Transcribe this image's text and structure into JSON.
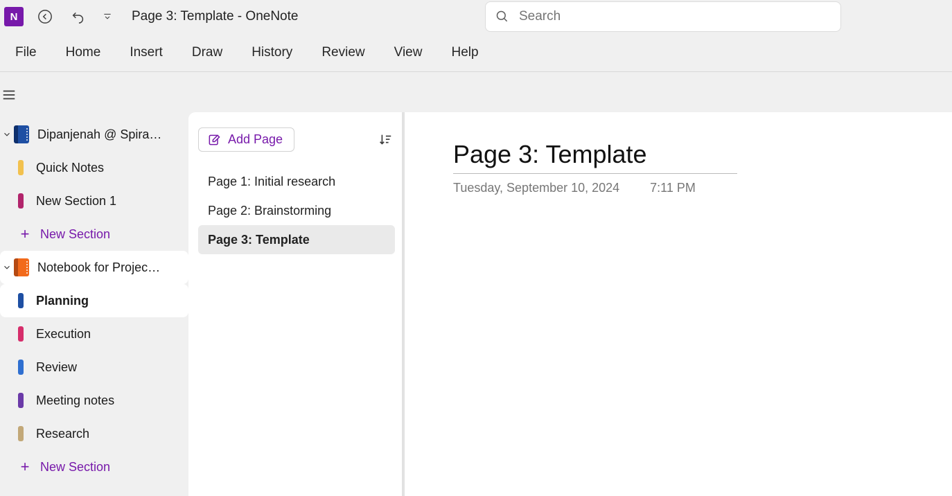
{
  "titlebar": {
    "doc_title": "Page 3: Template  -  OneNote",
    "search_placeholder": "Search",
    "app_icon_text": "N"
  },
  "ribbon": {
    "tabs": [
      "File",
      "Home",
      "Insert",
      "Draw",
      "History",
      "Review",
      "View",
      "Help"
    ]
  },
  "sidebar": {
    "notebooks": [
      {
        "name": "Dipanjenah @ Spiral...",
        "color_spine": "#0e2f6c",
        "color_cover": "#1e4fa3",
        "selected": false,
        "sections": [
          {
            "name": "Quick Notes",
            "color": "#f2c14e",
            "selected": false
          },
          {
            "name": "New Section 1",
            "color": "#b1246b",
            "selected": false
          }
        ]
      },
      {
        "name": "Notebook for Project A",
        "color_spine": "#b54a13",
        "color_cover": "#f26a1b",
        "selected": true,
        "sections": [
          {
            "name": "Planning",
            "color": "#1e4fa3",
            "selected": true
          },
          {
            "name": "Execution",
            "color": "#d62e6b",
            "selected": false
          },
          {
            "name": "Review",
            "color": "#2f6fd0",
            "selected": false
          },
          {
            "name": "Meeting notes",
            "color": "#6b3aa8",
            "selected": false
          },
          {
            "name": "Research",
            "color": "#c2a878",
            "selected": false
          }
        ]
      }
    ],
    "new_section_label": "New Section"
  },
  "pagelist": {
    "add_page_label": "Add Page",
    "pages": [
      {
        "name": "Page 1: Initial research",
        "selected": false
      },
      {
        "name": "Page 2: Brainstorming",
        "selected": false
      },
      {
        "name": "Page 3: Template",
        "selected": true
      }
    ]
  },
  "canvas": {
    "title": "Page 3: Template",
    "date": "Tuesday, September 10, 2024",
    "time": "7:11 PM"
  }
}
